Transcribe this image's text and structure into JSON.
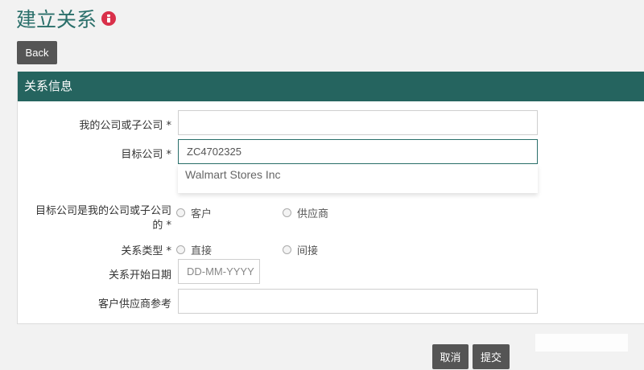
{
  "page": {
    "title": "建立关系",
    "back_label": "Back"
  },
  "panel": {
    "title": "关系信息"
  },
  "form": {
    "my_company": {
      "label": "我的公司或子公司 *",
      "value": ""
    },
    "target_company": {
      "label": "目标公司 *",
      "value": "ZC4702325",
      "suggestions": [
        "Walmart Stores Inc"
      ]
    },
    "target_is": {
      "label": "目标公司是我的公司或子公司的 *",
      "options": [
        "客户",
        "供应商"
      ]
    },
    "relation_type": {
      "label": "关系类型 *",
      "options": [
        "直接",
        "间接"
      ]
    },
    "start_date": {
      "label": "关系开始日期",
      "placeholder": "DD-MM-YYYY"
    },
    "reference": {
      "label": "客户供应商参考",
      "value": ""
    }
  },
  "actions": {
    "cancel_label": "取消",
    "submit_label": "提交"
  },
  "colors": {
    "title": "#2a6f6a",
    "panel_header": "#25645f",
    "button": "#555555",
    "info_icon": "#d9304a"
  },
  "icons": [
    "info-icon",
    "radio-icon"
  ]
}
